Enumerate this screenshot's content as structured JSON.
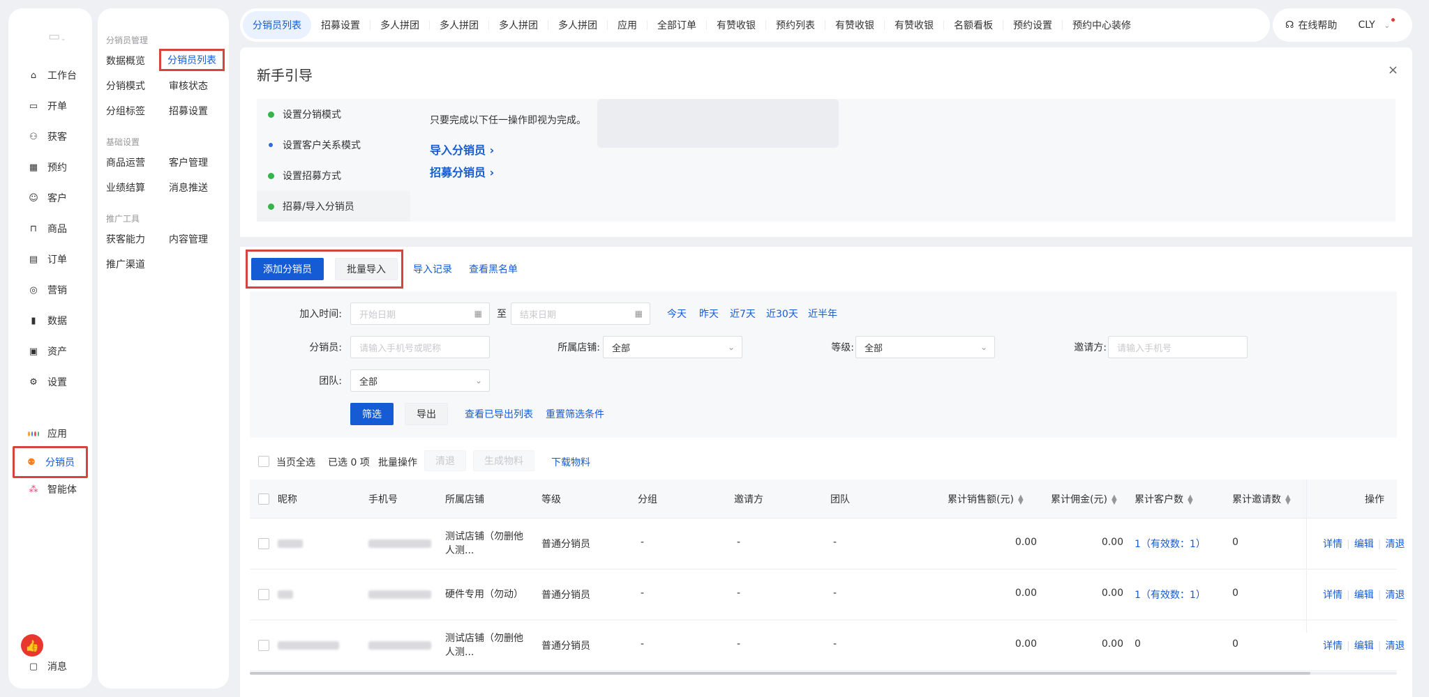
{
  "rail": {
    "items": [
      {
        "label": "工作台",
        "icon": "workbench-icon",
        "glyph": "⌂"
      },
      {
        "label": "开单",
        "icon": "billing-icon",
        "glyph": "▭"
      },
      {
        "label": "获客",
        "icon": "acquire-icon",
        "glyph": "⚇"
      },
      {
        "label": "预约",
        "icon": "calendar-icon",
        "glyph": "▦"
      },
      {
        "label": "客户",
        "icon": "customer-icon",
        "glyph": "☺"
      },
      {
        "label": "商品",
        "icon": "goods-icon",
        "glyph": "⊓"
      },
      {
        "label": "订单",
        "icon": "order-icon",
        "glyph": "▤"
      },
      {
        "label": "营销",
        "icon": "marketing-icon",
        "glyph": "◎"
      },
      {
        "label": "数据",
        "icon": "data-icon",
        "glyph": "▮"
      },
      {
        "label": "资产",
        "icon": "asset-icon",
        "glyph": "▣"
      },
      {
        "label": "设置",
        "icon": "settings-icon",
        "glyph": "⚙"
      }
    ],
    "apps_label": "应用",
    "distributor_label": "分销员",
    "agent_label": "智能体",
    "message_label": "消息"
  },
  "subnav": {
    "groups": [
      {
        "title": "分销员管理",
        "items": [
          "数据概览",
          "分销员列表",
          "分销模式",
          "审核状态",
          "分组标签",
          "招募设置"
        ]
      },
      {
        "title": "基础设置",
        "items": [
          "商品运营",
          "客户管理",
          "业绩结算",
          "消息推送"
        ]
      },
      {
        "title": "推广工具",
        "items": [
          "获客能力",
          "内容管理",
          "推广渠道"
        ]
      }
    ]
  },
  "tabs": [
    "分销员列表",
    "招募设置",
    "多人拼团",
    "多人拼团",
    "多人拼团",
    "多人拼团",
    "应用",
    "全部订单",
    "有赞收银",
    "预约列表",
    "有赞收银",
    "有赞收银",
    "名额看板",
    "预约设置",
    "预约中心装修"
  ],
  "userbar": {
    "help": "在线帮助",
    "user": "CLY"
  },
  "guide": {
    "title": "新手引导",
    "close": "×",
    "steps": [
      "设置分销模式",
      "设置客户关系模式",
      "设置招募方式",
      "招募/导入分销员"
    ],
    "hint": "只要完成以下任一操作即视为完成。",
    "links": [
      "导入分销员 ›",
      "招募分销员 ›"
    ]
  },
  "toolbar": {
    "add": "添加分销员",
    "import": "批量导入",
    "import_log": "导入记录",
    "blacklist": "查看黑名单"
  },
  "filter": {
    "join_time_label": "加入时间:",
    "start_placeholder": "开始日期",
    "to": "至",
    "end_placeholder": "结束日期",
    "quick": [
      "今天",
      "昨天",
      "近7天",
      "近30天",
      "近半年"
    ],
    "distributor_label": "分销员:",
    "distributor_placeholder": "请输入手机号或昵称",
    "store_label": "所属店铺:",
    "store_value": "全部",
    "level_label": "等级:",
    "level_value": "全部",
    "inviter_label": "邀请方:",
    "inviter_placeholder": "请输入手机号",
    "team_label": "团队:",
    "team_value": "全部",
    "filter_btn": "筛选",
    "export_btn": "导出",
    "view_exports": "查看已导出列表",
    "reset": "重置筛选条件"
  },
  "batch": {
    "select_page": "当页全选",
    "selected": "已选 0 项",
    "batch_ops": "批量操作",
    "clear": "清退",
    "gen_material": "生成物料",
    "download": "下载物料"
  },
  "table": {
    "headers": [
      "昵称",
      "手机号",
      "所属店铺",
      "等级",
      "分组",
      "邀请方",
      "团队",
      "累计销售额(元)",
      "累计佣金(元)",
      "累计客户数",
      "累计邀请数",
      "操作"
    ],
    "rows": [
      {
        "store": [
          "测试店铺（勿删他",
          "人测..."
        ],
        "level": "普通分销员",
        "group": "-",
        "inviter": "-",
        "team": "-",
        "sales": "0.00",
        "commission": "0.00",
        "customers": "1（有效数：1）",
        "invites": "0"
      },
      {
        "store": [
          "硬件专用（勿动）"
        ],
        "level": "普通分销员",
        "group": "-",
        "inviter": "-",
        "team": "-",
        "sales": "0.00",
        "commission": "0.00",
        "customers": "1（有效数：1）",
        "invites": "0"
      },
      {
        "store": [
          "测试店铺（勿删他",
          "人测..."
        ],
        "level": "普通分销员",
        "group": "-",
        "inviter": "-",
        "team": "-",
        "sales": "0.00",
        "commission": "0.00",
        "customers": "0",
        "invites": "0"
      }
    ],
    "actions": [
      "详情",
      "编辑",
      "清退"
    ]
  },
  "colors": {
    "accent": "#155bd4",
    "highlight": "#d6453d",
    "ok": "#36b349",
    "pending": "#2f6bd8"
  }
}
